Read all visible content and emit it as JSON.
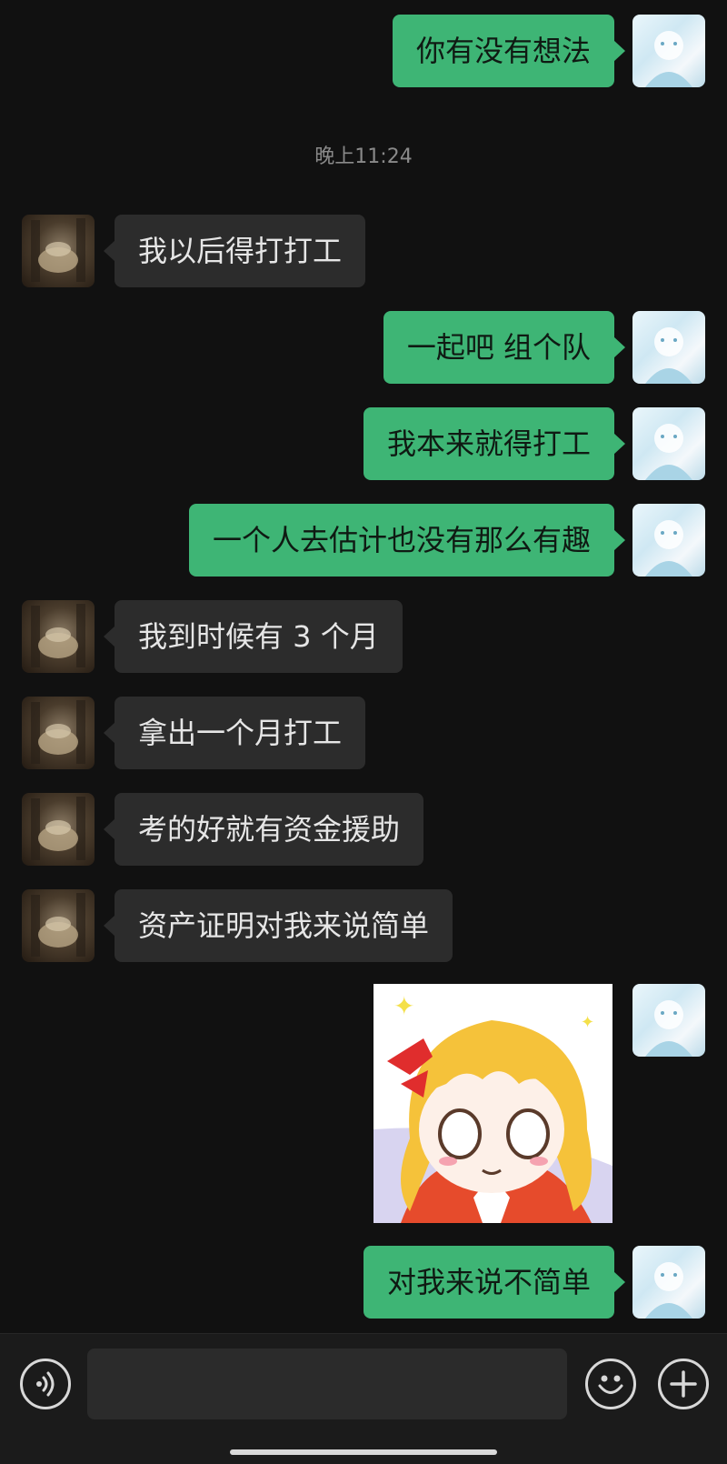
{
  "chat": {
    "timestamp": "晚上11:24",
    "messages": [
      {
        "sender": "self",
        "text": "你有没有想法"
      },
      {
        "sender": "other",
        "text": "我以后得打打工"
      },
      {
        "sender": "self",
        "text": "一起吧 组个队"
      },
      {
        "sender": "self",
        "text": "我本来就得打工"
      },
      {
        "sender": "self",
        "text": "一个人去估计也没有那么有趣"
      },
      {
        "sender": "other",
        "text": "我到时候有 3 个月"
      },
      {
        "sender": "other",
        "text": "拿出一个月打工"
      },
      {
        "sender": "other",
        "text": "考的好就有资金援助"
      },
      {
        "sender": "other",
        "text": "资产证明对我来说简单"
      },
      {
        "sender": "self",
        "type": "sticker",
        "sticker": "blonde-anime-girl-sticker"
      },
      {
        "sender": "self",
        "text": "对我来说不简单"
      }
    ]
  },
  "input_bar": {
    "voice_icon": "voice-icon",
    "emoji_icon": "emoji-icon",
    "plus_icon": "plus-icon",
    "message_value": ""
  },
  "colors": {
    "background": "#111111",
    "self_bubble": "#3eb575",
    "other_bubble": "#2c2c2c",
    "timestamp_text": "#8a8a8a"
  }
}
